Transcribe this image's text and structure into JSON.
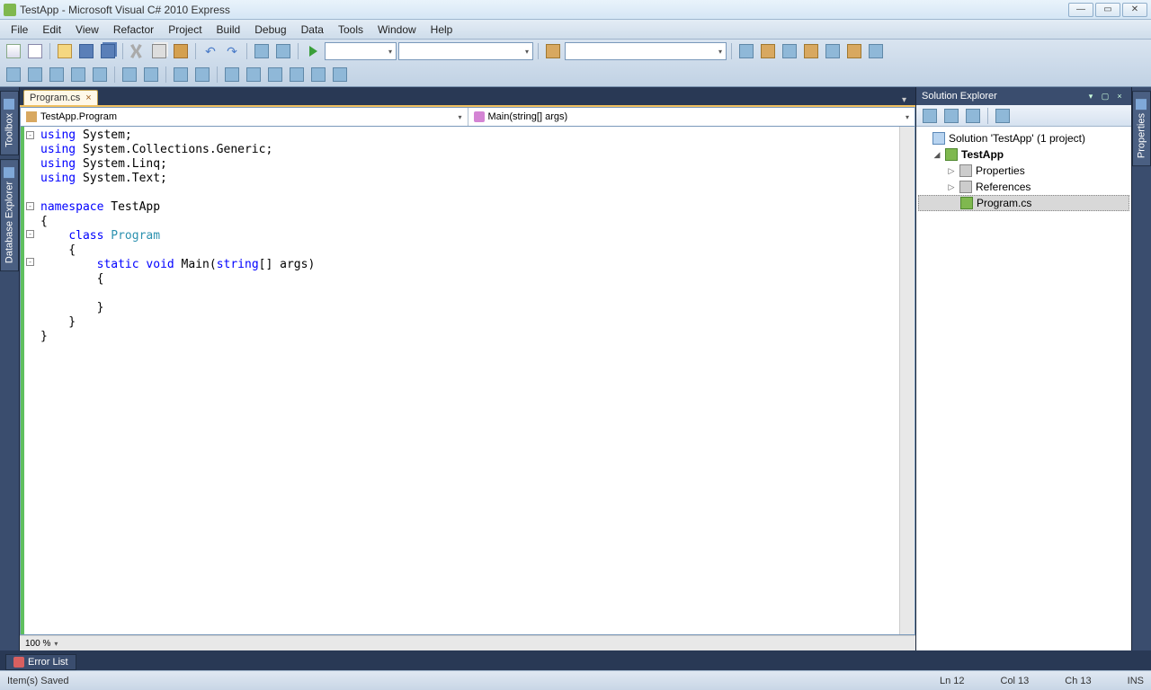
{
  "window": {
    "title": "TestApp - Microsoft Visual C# 2010 Express"
  },
  "menu": {
    "items": [
      "File",
      "Edit",
      "View",
      "Refactor",
      "Project",
      "Build",
      "Debug",
      "Data",
      "Tools",
      "Window",
      "Help"
    ]
  },
  "side_left": {
    "tabs": [
      "Toolbox",
      "Database Explorer"
    ]
  },
  "side_right": {
    "tabs": [
      "Properties"
    ]
  },
  "tabs": {
    "active": "Program.cs"
  },
  "nav": {
    "class_combo": "TestApp.Program",
    "member_combo": "Main(string[] args)"
  },
  "code": {
    "lines": [
      {
        "t": "using",
        "rest": " System;"
      },
      {
        "t": "using",
        "rest": " System.Collections.Generic;"
      },
      {
        "t": "using",
        "rest": " System.Linq;"
      },
      {
        "t": "using",
        "rest": " System.Text;"
      },
      {
        "t": "",
        "rest": ""
      },
      {
        "t": "namespace",
        "rest": " TestApp"
      },
      {
        "t": "",
        "rest": "{"
      },
      {
        "t": "",
        "rest": "    ",
        "kw2": "class",
        "type": " Program"
      },
      {
        "t": "",
        "rest": "    {"
      },
      {
        "t": "",
        "rest": "        ",
        "kw2": "static void",
        "mid": " Main(",
        "kw3": "string",
        "tail": "[] args)"
      },
      {
        "t": "",
        "rest": "        {"
      },
      {
        "t": "",
        "rest": ""
      },
      {
        "t": "",
        "rest": "        }"
      },
      {
        "t": "",
        "rest": "    }"
      },
      {
        "t": "",
        "rest": "}"
      }
    ]
  },
  "zoom": "100 %",
  "solution": {
    "title": "Solution Explorer",
    "root": "Solution 'TestApp' (1 project)",
    "project": "TestApp",
    "nodes": {
      "properties": "Properties",
      "references": "References",
      "program": "Program.cs"
    }
  },
  "bottom": {
    "error_list": "Error List"
  },
  "status": {
    "msg": "Item(s) Saved",
    "ln": "Ln 12",
    "col": "Col 13",
    "ch": "Ch 13",
    "ins": "INS"
  }
}
